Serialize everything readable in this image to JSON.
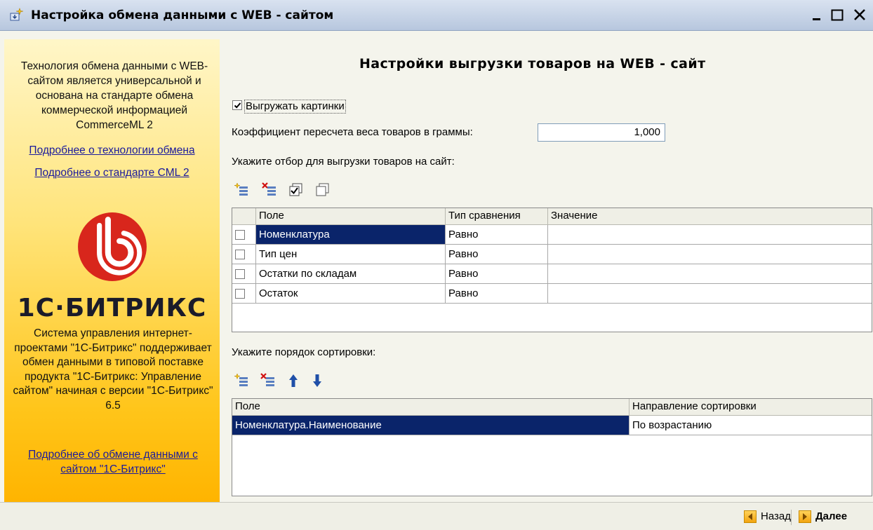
{
  "window": {
    "title": "Настройка обмена данными с WEB - сайтом"
  },
  "sidebar": {
    "intro": "Технология обмена данными с WEB-сайтом является универсальной и основана на стандарте обмена коммерческой информацией CommerceML 2",
    "link_tech": "Подробнее о технологии обмена",
    "link_cml": "Подробнее о стандарте CML 2",
    "brand": "1С·БИТРИКС",
    "description": "Система управления интернет-проектами \"1С-Битрикс\" поддерживает обмен данными в типовой поставке продукта \"1С-Битрикс: Управление сайтом\" начиная с версии \"1С-Битрикс\" 6.5",
    "link_bitrix": "Подробнее об обмене данными с сайтом \"1С-Битрикс\""
  },
  "main": {
    "title": "Настройки выгрузки товаров на WEB - сайт",
    "export_images": {
      "label": "Выгружать картинки",
      "checked": true
    },
    "weight_coef": {
      "label": "Коэффициент пересчета веса товаров в граммы:",
      "value": "1,000"
    },
    "filter_label": "Укажите отбор для выгрузки товаров на сайт:",
    "filter_table": {
      "headers": [
        "Поле",
        "Тип сравнения",
        "Значение"
      ],
      "rows": [
        {
          "field": "Номенклатура",
          "comparison": "Равно",
          "value": "",
          "checked": false
        },
        {
          "field": "Тип цен",
          "comparison": "Равно",
          "value": "",
          "checked": false
        },
        {
          "field": "Остатки по складам",
          "comparison": "Равно",
          "value": "",
          "checked": false
        },
        {
          "field": "Остаток",
          "comparison": "Равно",
          "value": "",
          "checked": false
        }
      ]
    },
    "sort_label": "Укажите порядок сортировки:",
    "sort_table": {
      "headers": [
        "Поле",
        "Направление сортировки"
      ],
      "rows": [
        {
          "field": "Номенклатура.Наименование",
          "direction": "По возрастанию"
        }
      ]
    }
  },
  "footer": {
    "back_label": "Назад",
    "next_label": "Далее"
  },
  "colors": {
    "selection": "#0a246a",
    "sidebar_top": "#fff6c8",
    "sidebar_bottom": "#ffb400",
    "bitrix_red": "#d8261c"
  }
}
